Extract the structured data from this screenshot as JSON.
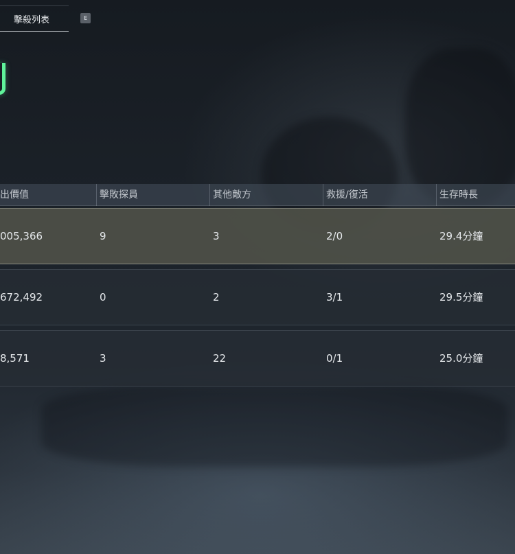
{
  "tab": {
    "label": "擊殺列表",
    "key_hint": "E"
  },
  "table": {
    "headers": [
      "出價值",
      "擊敗探員",
      "其他敵方",
      "救援/復活",
      "生存時長"
    ],
    "rows": [
      {
        "value": "005,366",
        "agents_defeated": "9",
        "other_enemies": "3",
        "rescue_revive": "2/0",
        "survival_time": "29.4分鐘",
        "highlighted": true
      },
      {
        "value": "672,492",
        "agents_defeated": "0",
        "other_enemies": "2",
        "rescue_revive": "3/1",
        "survival_time": "29.5分鐘",
        "highlighted": false
      },
      {
        "value": "8,571",
        "agents_defeated": "3",
        "other_enemies": "22",
        "rescue_revive": "0/1",
        "survival_time": "25.0分鐘",
        "highlighted": false
      }
    ]
  },
  "colors": {
    "accent_green": "#5ff29a",
    "highlight_row": "#4e5048"
  }
}
